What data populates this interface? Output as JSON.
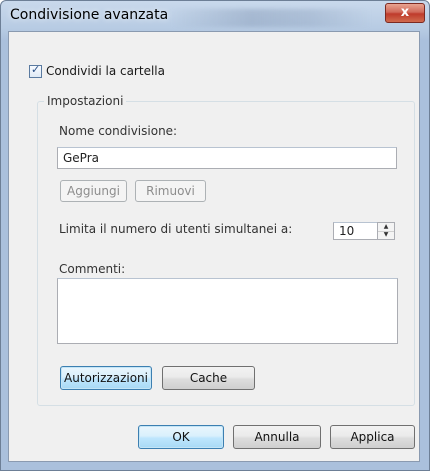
{
  "window": {
    "title": "Condivisione avanzata",
    "close_glyph": "x"
  },
  "share_checkbox": {
    "label": "Condividi la cartella",
    "checked": true
  },
  "settings": {
    "group_label": "Impostazioni",
    "share_name_label": "Nome condivisione:",
    "share_name_value": "GePra",
    "add_label": "Aggiungi",
    "remove_label": "Rimuovi",
    "user_limit_label": "Limita il numero di utenti simultanei a:",
    "user_limit_value": "10",
    "comments_label": "Commenti:",
    "comments_value": "",
    "permissions_label": "Autorizzazioni",
    "cache_label": "Cache"
  },
  "footer": {
    "ok_label": "OK",
    "cancel_label": "Annulla",
    "apply_label": "Applica"
  }
}
